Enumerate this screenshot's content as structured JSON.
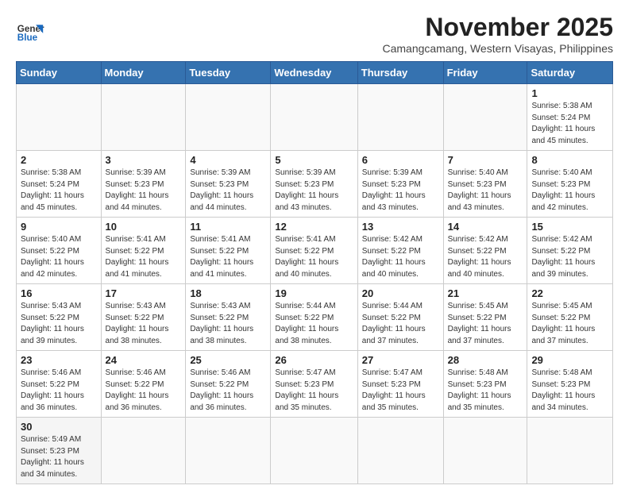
{
  "header": {
    "logo_line1": "General",
    "logo_line2": "Blue",
    "month_title": "November 2025",
    "subtitle": "Camangcamang, Western Visayas, Philippines"
  },
  "days_of_week": [
    "Sunday",
    "Monday",
    "Tuesday",
    "Wednesday",
    "Thursday",
    "Friday",
    "Saturday"
  ],
  "weeks": [
    [
      {
        "day": "",
        "info": ""
      },
      {
        "day": "",
        "info": ""
      },
      {
        "day": "",
        "info": ""
      },
      {
        "day": "",
        "info": ""
      },
      {
        "day": "",
        "info": ""
      },
      {
        "day": "",
        "info": ""
      },
      {
        "day": "1",
        "info": "Sunrise: 5:38 AM\nSunset: 5:24 PM\nDaylight: 11 hours and 45 minutes."
      }
    ],
    [
      {
        "day": "2",
        "info": "Sunrise: 5:38 AM\nSunset: 5:24 PM\nDaylight: 11 hours and 45 minutes."
      },
      {
        "day": "3",
        "info": "Sunrise: 5:39 AM\nSunset: 5:23 PM\nDaylight: 11 hours and 44 minutes."
      },
      {
        "day": "4",
        "info": "Sunrise: 5:39 AM\nSunset: 5:23 PM\nDaylight: 11 hours and 44 minutes."
      },
      {
        "day": "5",
        "info": "Sunrise: 5:39 AM\nSunset: 5:23 PM\nDaylight: 11 hours and 43 minutes."
      },
      {
        "day": "6",
        "info": "Sunrise: 5:39 AM\nSunset: 5:23 PM\nDaylight: 11 hours and 43 minutes."
      },
      {
        "day": "7",
        "info": "Sunrise: 5:40 AM\nSunset: 5:23 PM\nDaylight: 11 hours and 43 minutes."
      },
      {
        "day": "8",
        "info": "Sunrise: 5:40 AM\nSunset: 5:23 PM\nDaylight: 11 hours and 42 minutes."
      }
    ],
    [
      {
        "day": "9",
        "info": "Sunrise: 5:40 AM\nSunset: 5:22 PM\nDaylight: 11 hours and 42 minutes."
      },
      {
        "day": "10",
        "info": "Sunrise: 5:41 AM\nSunset: 5:22 PM\nDaylight: 11 hours and 41 minutes."
      },
      {
        "day": "11",
        "info": "Sunrise: 5:41 AM\nSunset: 5:22 PM\nDaylight: 11 hours and 41 minutes."
      },
      {
        "day": "12",
        "info": "Sunrise: 5:41 AM\nSunset: 5:22 PM\nDaylight: 11 hours and 40 minutes."
      },
      {
        "day": "13",
        "info": "Sunrise: 5:42 AM\nSunset: 5:22 PM\nDaylight: 11 hours and 40 minutes."
      },
      {
        "day": "14",
        "info": "Sunrise: 5:42 AM\nSunset: 5:22 PM\nDaylight: 11 hours and 40 minutes."
      },
      {
        "day": "15",
        "info": "Sunrise: 5:42 AM\nSunset: 5:22 PM\nDaylight: 11 hours and 39 minutes."
      }
    ],
    [
      {
        "day": "16",
        "info": "Sunrise: 5:43 AM\nSunset: 5:22 PM\nDaylight: 11 hours and 39 minutes."
      },
      {
        "day": "17",
        "info": "Sunrise: 5:43 AM\nSunset: 5:22 PM\nDaylight: 11 hours and 38 minutes."
      },
      {
        "day": "18",
        "info": "Sunrise: 5:43 AM\nSunset: 5:22 PM\nDaylight: 11 hours and 38 minutes."
      },
      {
        "day": "19",
        "info": "Sunrise: 5:44 AM\nSunset: 5:22 PM\nDaylight: 11 hours and 38 minutes."
      },
      {
        "day": "20",
        "info": "Sunrise: 5:44 AM\nSunset: 5:22 PM\nDaylight: 11 hours and 37 minutes."
      },
      {
        "day": "21",
        "info": "Sunrise: 5:45 AM\nSunset: 5:22 PM\nDaylight: 11 hours and 37 minutes."
      },
      {
        "day": "22",
        "info": "Sunrise: 5:45 AM\nSunset: 5:22 PM\nDaylight: 11 hours and 37 minutes."
      }
    ],
    [
      {
        "day": "23",
        "info": "Sunrise: 5:46 AM\nSunset: 5:22 PM\nDaylight: 11 hours and 36 minutes."
      },
      {
        "day": "24",
        "info": "Sunrise: 5:46 AM\nSunset: 5:22 PM\nDaylight: 11 hours and 36 minutes."
      },
      {
        "day": "25",
        "info": "Sunrise: 5:46 AM\nSunset: 5:22 PM\nDaylight: 11 hours and 36 minutes."
      },
      {
        "day": "26",
        "info": "Sunrise: 5:47 AM\nSunset: 5:23 PM\nDaylight: 11 hours and 35 minutes."
      },
      {
        "day": "27",
        "info": "Sunrise: 5:47 AM\nSunset: 5:23 PM\nDaylight: 11 hours and 35 minutes."
      },
      {
        "day": "28",
        "info": "Sunrise: 5:48 AM\nSunset: 5:23 PM\nDaylight: 11 hours and 35 minutes."
      },
      {
        "day": "29",
        "info": "Sunrise: 5:48 AM\nSunset: 5:23 PM\nDaylight: 11 hours and 34 minutes."
      }
    ],
    [
      {
        "day": "30",
        "info": "Sunrise: 5:49 AM\nSunset: 5:23 PM\nDaylight: 11 hours and 34 minutes."
      },
      {
        "day": "",
        "info": ""
      },
      {
        "day": "",
        "info": ""
      },
      {
        "day": "",
        "info": ""
      },
      {
        "day": "",
        "info": ""
      },
      {
        "day": "",
        "info": ""
      },
      {
        "day": "",
        "info": ""
      }
    ]
  ]
}
